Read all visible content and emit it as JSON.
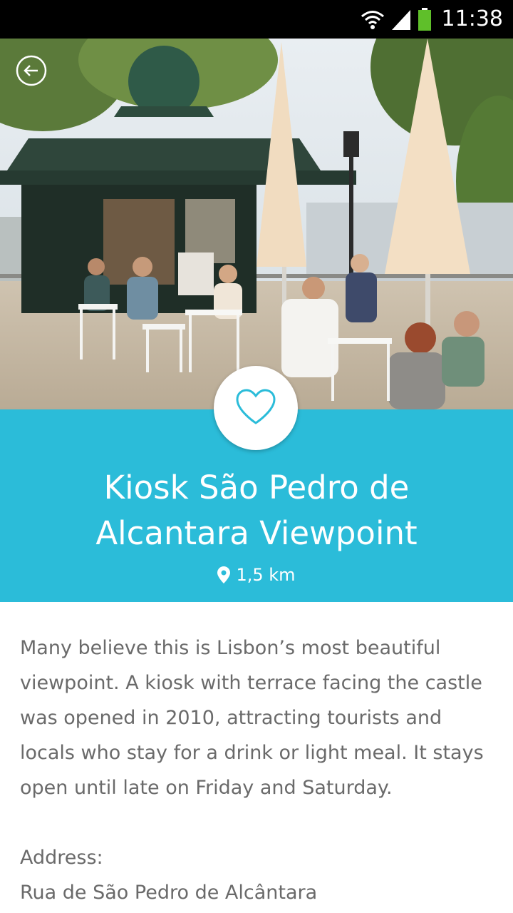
{
  "status_bar": {
    "time": "11:38",
    "icons": [
      "wifi-icon",
      "signal-icon",
      "battery-icon"
    ],
    "battery_color": "#5fbf2a"
  },
  "hero": {
    "image": "photo of a kiosk café terrace with white chairs and closed umbrellas",
    "back_icon": "back-arrow-icon"
  },
  "favorite": {
    "icon": "heart-outline-icon"
  },
  "place": {
    "title": "Kiosk São Pedro de Alcantara Viewpoint",
    "distance": "1,5 km",
    "distance_icon": "map-pin-icon"
  },
  "details": {
    "description": "Many believe this is Lisbon’s most beautiful viewpoint. A kiosk with terrace facing the castle was opened in 2010, attracting tourists and locals who stay for a drink or light meal. It stays open until late on Friday and Saturday.",
    "address_label": "Address:",
    "address_value": "Rua de São Pedro de Alcântara"
  },
  "colors": {
    "accent": "#2bbcd9",
    "status_bar": "#000000",
    "body_text": "#6a6a6a"
  }
}
